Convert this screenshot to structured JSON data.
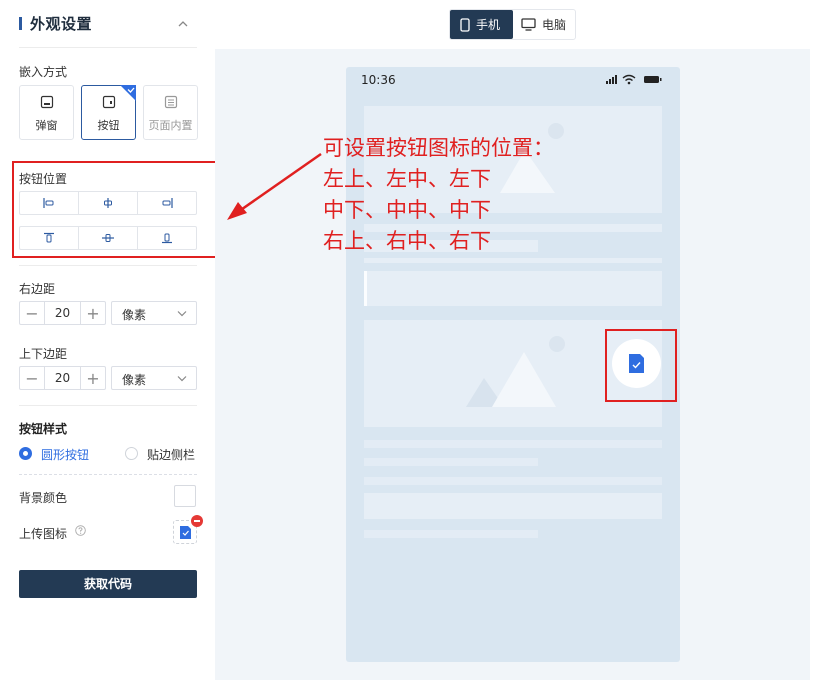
{
  "panel": {
    "title": "外观设置",
    "embed_mode": {
      "label": "嵌入方式",
      "options": [
        {
          "label": "弹窗",
          "state": "normal"
        },
        {
          "label": "按钮",
          "state": "selected"
        },
        {
          "label": "页面内置",
          "state": "disabled"
        }
      ]
    },
    "button_position": {
      "label": "按钮位置",
      "rows": [
        [
          "left",
          "center",
          "right"
        ],
        [
          "top",
          "middle",
          "bottom"
        ]
      ]
    },
    "right_margin": {
      "label": "右边距",
      "value": "20",
      "unit": "像素"
    },
    "vertical_margin": {
      "label": "上下边距",
      "value": "20",
      "unit": "像素"
    },
    "button_style": {
      "label": "按钮样式",
      "options": [
        {
          "label": "圆形按钮",
          "checked": true
        },
        {
          "label": "贴边侧栏",
          "checked": false
        }
      ]
    },
    "background_color": {
      "label": "背景颜色",
      "value": "#ffffff"
    },
    "upload_icon": {
      "label": "上传图标"
    },
    "get_code_label": "获取代码"
  },
  "device_toggle": {
    "phone_label": "手机",
    "pc_label": "电脑",
    "active": "phone"
  },
  "preview": {
    "status_time": "10:36"
  },
  "annotation": {
    "lines": [
      "可设置按钮图标的位置：",
      "左上、左中、左下",
      "中下、中中、中下",
      "右上、右中、右下"
    ]
  },
  "colors": {
    "accent": "#233a54",
    "highlight": "#e02020",
    "primary_blue": "#2f6de0"
  }
}
